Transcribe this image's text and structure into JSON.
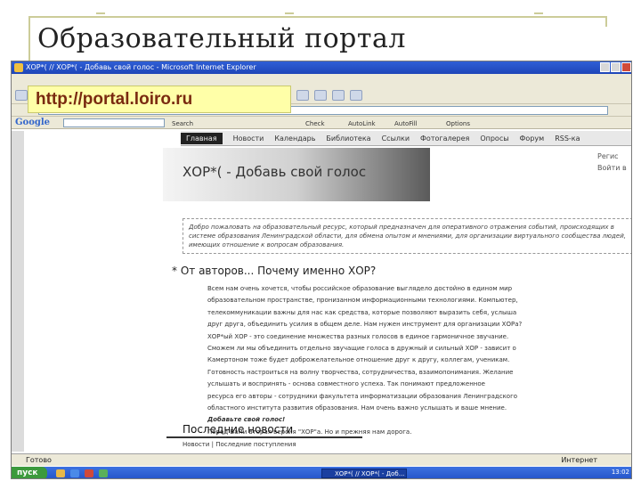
{
  "slide": {
    "title": "Образовательный портал"
  },
  "url_overlay": "http://portal.loiro.ru",
  "browser": {
    "window_title": "ХОР*( // ХОР*( - Добавь свой голос - Microsoft Internet Explorer",
    "google_label": "Google",
    "google_buttons": [
      "Search",
      "Check",
      "AutoLink",
      "AutoFill",
      "Options"
    ]
  },
  "site": {
    "nav": [
      "Главная",
      "Новости",
      "Календарь",
      "Библиотека",
      "Ссылки",
      "Фотогалерея",
      "Опросы",
      "Форум",
      "RSS-ка"
    ],
    "banner_title": "ХОР*( - Добавь свой голос",
    "side_links": [
      "Регис",
      "Войти в"
    ],
    "welcome": "Добро пожаловать на образовательный ресурс, который предназначен для оперативного отражения событий, происходящих в системе образования Ленинградской области, для обмена опытом и мнениями, для организации виртуального сообщества людей, имеющих отношение к вопросам образования.",
    "authors_heading": "* От авторов... Почему именно ХОР?",
    "authors_paragraphs": [
      "Всем нам очень хочется, чтобы российское образование выглядело достойно в едином мир",
      "образовательном пространстве, пронизанном информационными технологиями. Компьютер,",
      "телекоммуникации важны для нас как средства, которые позволяют выразить себя, услыша",
      "друг друга, объединить усилия в общем деле. Нам нужен инструмент для организации ХОРа?",
      "ХОР*ый ХОР - это соединение множества разных голосов в единое гармоничное звучание.",
      "Сможем ли мы объединить отдельно звучащие голоса в дружный и сильный ХОР - зависит о",
      "Камертоном тоже будет доброжелательное отношение друг к другу, коллегам, ученикам.",
      "Готовность настроиться на волну творчества, сотрудничества, взаимопонимания. Желание",
      "услышать и воспринять - основа совместного успеха. Так понимают предложенное",
      "ресурса его авторы - сотрудники факультета информатизации образования Ленинградского",
      "областного института развития образования. Нам очень важно услышать и ваше мнение.",
      "Добавьте свой голос!"
    ],
    "version_note": "Перед Вами вторая версия \"ХОР\"а. Но и прежняя нам дорога.",
    "version_link": "прежняя",
    "news_heading": "Последние новости",
    "news_links": "Новости | Последние поступления"
  },
  "status": {
    "left": "Готово",
    "right": "Интернет"
  },
  "taskbar": {
    "start": "пуск",
    "task": "ХОР*( // ХОР*( - Доб...",
    "time": "13:02"
  }
}
